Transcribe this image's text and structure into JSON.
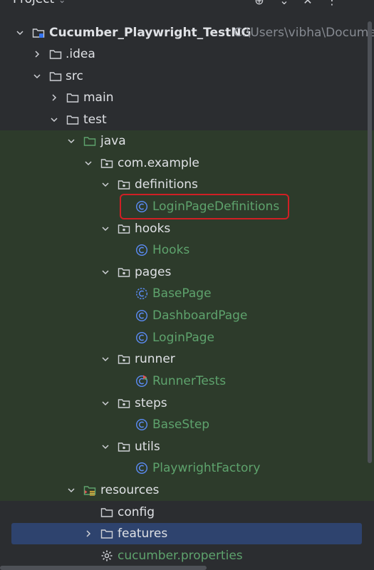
{
  "panel": {
    "title": "Project",
    "actions": [
      "target-icon",
      "chevron-down-icon",
      "close-icon",
      "more-icon"
    ]
  },
  "tree": {
    "root_label": "Cucumber_Playwright_TestNG",
    "root_path": "C:\\Users\\vibha\\Documen",
    "idea": ".idea",
    "src": "src",
    "main": "main",
    "test": "test",
    "java": "java",
    "com_example": "com.example",
    "definitions": "definitions",
    "login_page_definitions": "LoginPageDefinitions",
    "hooks": "hooks",
    "hooks_class": "Hooks",
    "pages": "pages",
    "base_page": "BasePage",
    "dashboard_page": "DashboardPage",
    "login_page": "LoginPage",
    "runner": "runner",
    "runner_tests": "RunnerTests",
    "steps": "steps",
    "base_step": "BaseStep",
    "utils": "utils",
    "playwright_factory": "PlaywrightFactory",
    "resources": "resources",
    "config": "config",
    "features": "features",
    "cucumber_properties": "cucumber.properties"
  },
  "colors": {
    "background": "#2b2d30",
    "test_scope_background": "#2d3b2b",
    "selection": "#2e436e",
    "class_text": "#5ea36d",
    "class_icon": "#5b8cf5",
    "highlight_border": "#d01f24"
  }
}
